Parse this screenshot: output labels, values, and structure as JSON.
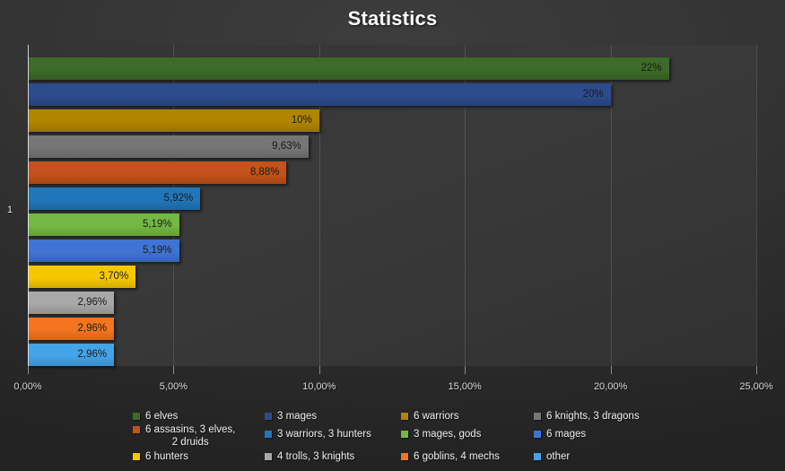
{
  "title": "Statistics",
  "axis": {
    "y_category_label": "1",
    "x_ticks": [
      "0,00%",
      "5,00%",
      "10,00%",
      "15,00%",
      "20,00%",
      "25,00%"
    ]
  },
  "chart_data": {
    "type": "bar",
    "orientation": "horizontal",
    "title": "Statistics",
    "xlabel": "",
    "ylabel": "",
    "xlim": [
      0,
      25
    ],
    "x_tick_values": [
      0,
      5,
      10,
      15,
      20,
      25
    ],
    "x_tick_labels": [
      "0,00%",
      "5,00%",
      "10,00%",
      "15,00%",
      "20,00%",
      "25,00%"
    ],
    "grid": true,
    "legend_position": "bottom",
    "categories": [
      "1"
    ],
    "series": [
      {
        "name": "6 elves",
        "values": [
          22.0
        ],
        "label": "22%",
        "color": "#3d6b28"
      },
      {
        "name": "3 mages",
        "values": [
          20.0
        ],
        "label": "20%",
        "color": "#2c4c8c"
      },
      {
        "name": "6 warriors",
        "values": [
          10.0
        ],
        "label": "10%",
        "color": "#b08500"
      },
      {
        "name": "6 knights, 3 dragons",
        "values": [
          9.63
        ],
        "label": "9,63%",
        "color": "#767676"
      },
      {
        "name": "6 assasins, 3 elves,\n2 druids",
        "values": [
          8.88
        ],
        "label": "8,88%",
        "color": "#c4521a"
      },
      {
        "name": "3 warriors, 3 hunters",
        "values": [
          5.92
        ],
        "label": "5,92%",
        "color": "#2176ba"
      },
      {
        "name": "3 mages, gods",
        "values": [
          5.19
        ],
        "label": "5,19%",
        "color": "#74b843"
      },
      {
        "name": "6 mages",
        "values": [
          5.19
        ],
        "label": "5,19%",
        "color": "#4074d4"
      },
      {
        "name": "6 hunters",
        "values": [
          3.7
        ],
        "label": "3,70%",
        "color": "#f6c800"
      },
      {
        "name": "4 trolls, 3 knights",
        "values": [
          2.96
        ],
        "label": "2,96%",
        "color": "#a8a8a8"
      },
      {
        "name": "6 goblins, 4 mechs",
        "values": [
          2.96
        ],
        "label": "2,96%",
        "color": "#f3751f"
      },
      {
        "name": "other",
        "values": [
          2.96
        ],
        "label": "2,96%",
        "color": "#44a4e8"
      }
    ]
  },
  "legend": {
    "items": [
      {
        "label": "6 elves",
        "color": "#3d6b28",
        "col": 0,
        "row": 0
      },
      {
        "label": "6 assasins, 3 elves,\n2 druids",
        "color": "#c4521a",
        "col": 0,
        "row": 1
      },
      {
        "label": "6 hunters",
        "color": "#f6c800",
        "col": 0,
        "row": 2
      },
      {
        "label": "3 mages",
        "color": "#2c4c8c",
        "col": 1,
        "row": 0
      },
      {
        "label": "3 warriors, 3 hunters",
        "color": "#2176ba",
        "col": 1,
        "row": 1
      },
      {
        "label": "4 trolls, 3 knights",
        "color": "#a8a8a8",
        "col": 1,
        "row": 2
      },
      {
        "label": "6 warriors",
        "color": "#b08500",
        "col": 2,
        "row": 0
      },
      {
        "label": "3 mages, gods",
        "color": "#74b843",
        "col": 2,
        "row": 1
      },
      {
        "label": "6 goblins, 4 mechs",
        "color": "#f3751f",
        "col": 2,
        "row": 2
      },
      {
        "label": "6 knights, 3 dragons",
        "color": "#767676",
        "col": 3,
        "row": 0
      },
      {
        "label": "6 mages",
        "color": "#4074d4",
        "col": 3,
        "row": 1
      },
      {
        "label": "other",
        "color": "#44a4e8",
        "col": 3,
        "row": 2
      }
    ]
  }
}
